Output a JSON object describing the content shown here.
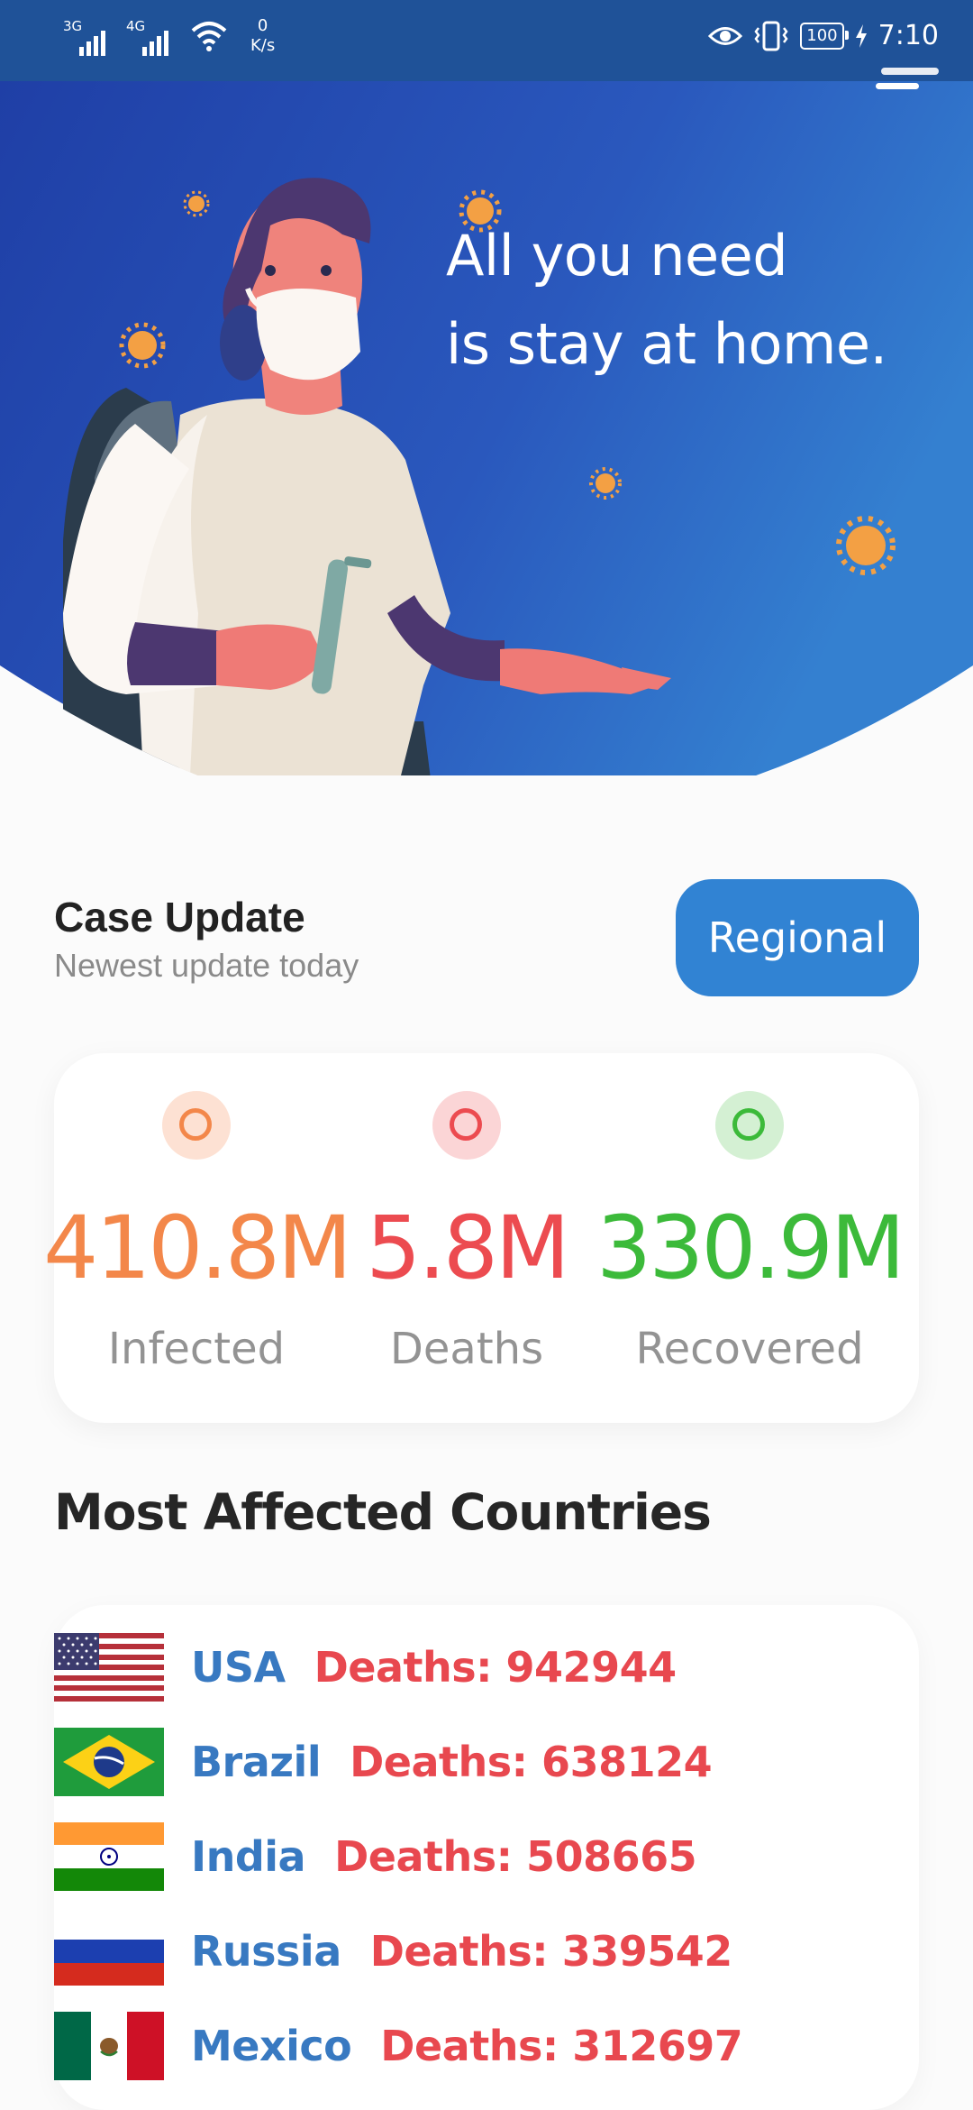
{
  "status_bar": {
    "sim1_tag": "3G",
    "sim2_tag": "4G",
    "net_speed_value": "0",
    "net_speed_unit": "K/s",
    "battery": "100",
    "time": "7:10"
  },
  "hero": {
    "line1": "All you need",
    "line2": "is stay at home."
  },
  "case_update": {
    "title": "Case Update",
    "subtitle": "Newest update today",
    "regional_button": "Regional"
  },
  "stats": [
    {
      "value": "410.8M",
      "label": "Infected",
      "color": "#f3874a",
      "bg": "#fde1d3"
    },
    {
      "value": "5.8M",
      "label": "Deaths",
      "color": "#ec4b50",
      "bg": "#fbd5d6"
    },
    {
      "value": "330.9M",
      "label": "Recovered",
      "color": "#3cba3a",
      "bg": "#d4f0d3"
    }
  ],
  "countries_title": "Most Affected Countries",
  "countries": [
    {
      "name": "USA",
      "deaths": "Deaths: 942944",
      "flag": "usa"
    },
    {
      "name": "Brazil",
      "deaths": "Deaths: 638124",
      "flag": "brazil"
    },
    {
      "name": "India",
      "deaths": "Deaths: 508665",
      "flag": "india"
    },
    {
      "name": "Russia",
      "deaths": "Deaths: 339542",
      "flag": "russia"
    },
    {
      "name": "Mexico",
      "deaths": "Deaths: 312697",
      "flag": "mexico"
    }
  ]
}
